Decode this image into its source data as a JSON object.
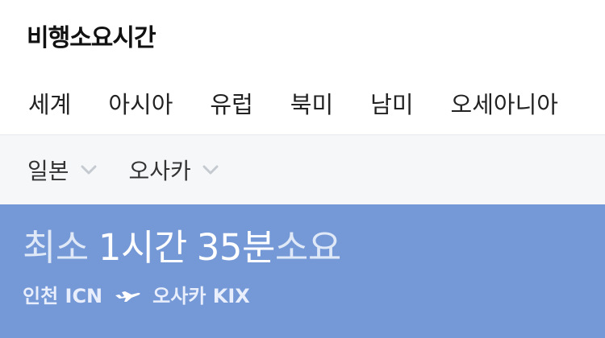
{
  "header": {
    "title": "비행소요시간"
  },
  "tabs": [
    {
      "label": "세계"
    },
    {
      "label": "아시아"
    },
    {
      "label": "유럽"
    },
    {
      "label": "북미"
    },
    {
      "label": "남미"
    },
    {
      "label": "오세아니아"
    }
  ],
  "filters": {
    "country": {
      "label": "일본",
      "icon": "chevron-down-icon"
    },
    "city": {
      "label": "오사카",
      "icon": "chevron-down-icon"
    }
  },
  "result": {
    "prefix": "최소",
    "hours_value": "1시간",
    "minutes_value": "35분",
    "suffix": "소요",
    "origin": "인천 ICN",
    "destination": "오사카 KIX",
    "route_icon": "airplane-icon"
  },
  "colors": {
    "banner_bg": "#7598d7",
    "filter_bg": "#f6f7f9",
    "chevron": "#c5c9d0"
  }
}
